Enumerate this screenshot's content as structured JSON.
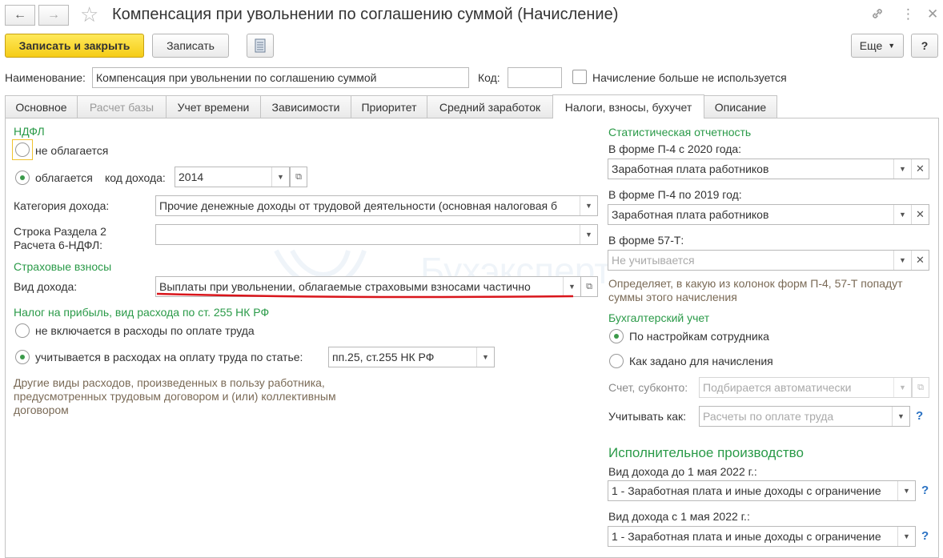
{
  "window": {
    "title": "Компенсация при увольнении по соглашению суммой (Начисление)"
  },
  "toolbar": {
    "save_close_label": "Записать и закрыть",
    "save_label": "Записать",
    "more_label": "Еще",
    "help_label": "?"
  },
  "header": {
    "name_label": "Наименование:",
    "name_value": "Компенсация при увольнении по соглашению суммой",
    "code_label": "Код:",
    "code_value": "",
    "unused_label": "Начисление больше не используется"
  },
  "tabs": [
    {
      "label": "Основное"
    },
    {
      "label": "Расчет базы"
    },
    {
      "label": "Учет времени"
    },
    {
      "label": "Зависимости"
    },
    {
      "label": "Приоритет"
    },
    {
      "label": "Средний заработок"
    },
    {
      "label": "Налоги, взносы, бухучет"
    },
    {
      "label": "Описание"
    }
  ],
  "ndfl": {
    "section": "НДФЛ",
    "not_taxed": "не облагается",
    "taxed": "облагается",
    "income_code_label": "код дохода:",
    "income_code_value": "2014",
    "category_label": "Категория дохода:",
    "category_value": "Прочие денежные доходы от трудовой деятельности (основная налоговая б",
    "row_label_1": "Строка Раздела 2",
    "row_label_2": "Расчета 6-НДФЛ:",
    "row_value": ""
  },
  "insurance": {
    "section": "Страховые взносы",
    "income_type_label": "Вид дохода:",
    "income_type_value": "Выплаты при увольнении, облагаемые страховыми взносами частично"
  },
  "profit_tax": {
    "section": "Налог на прибыль, вид расхода по ст. 255 НК РФ",
    "not_included": "не включается в расходы по оплате труда",
    "included": "учитывается в расходах на оплату труда по статье:",
    "article_value": "пп.25, ст.255 НК РФ",
    "note_1": "Другие виды расходов, произведенных в пользу работника,",
    "note_2": "предусмотренных трудовым договором и (или) коллективным",
    "note_3": "договором"
  },
  "statistics": {
    "section": "Статистическая отчетность",
    "p4_2020_label": "В форме П-4 с 2020 года:",
    "p4_2020_value": "Заработная плата работников",
    "p4_2019_label": "В форме П-4 по 2019 год:",
    "p4_2019_value": "Заработная плата работников",
    "f57_label": "В форме 57-Т:",
    "f57_placeholder": "Не учитывается",
    "note_1": "Определяет, в какую из колонок форм П-4, 57-Т попадут",
    "note_2": "суммы этого начисления"
  },
  "accounting": {
    "section": "Бухгалтерский учет",
    "by_employee": "По настройкам сотрудника",
    "as_set": "Как задано для начисления",
    "account_label": "Счет, субконто:",
    "account_placeholder": "Подбирается автоматически",
    "account_as_label": "Учитывать как:",
    "account_as_placeholder": "Расчеты по оплате труда"
  },
  "enforcement": {
    "section": "Исполнительное производство",
    "before_label": "Вид дохода до 1 мая 2022 г.:",
    "before_value": "1 - Заработная плата и иные доходы с ограничение",
    "after_label": "Вид дохода с 1 мая 2022 г.:",
    "after_value": "1 - Заработная плата и иные доходы с ограничение"
  },
  "watermark": {
    "text": "Бухэксперт"
  },
  "colors": {
    "accent_green": "#2a9a48",
    "primary_yellow": "#f5cc17",
    "underline_red": "#d9151b",
    "help_blue": "#2a72c3"
  },
  "icons": {
    "back": "arrow-left-icon",
    "forward": "arrow-right-icon",
    "favorite": "star-icon",
    "link": "link-icon",
    "menu": "more-vertical-icon",
    "close": "close-icon",
    "report": "document-list-icon"
  }
}
